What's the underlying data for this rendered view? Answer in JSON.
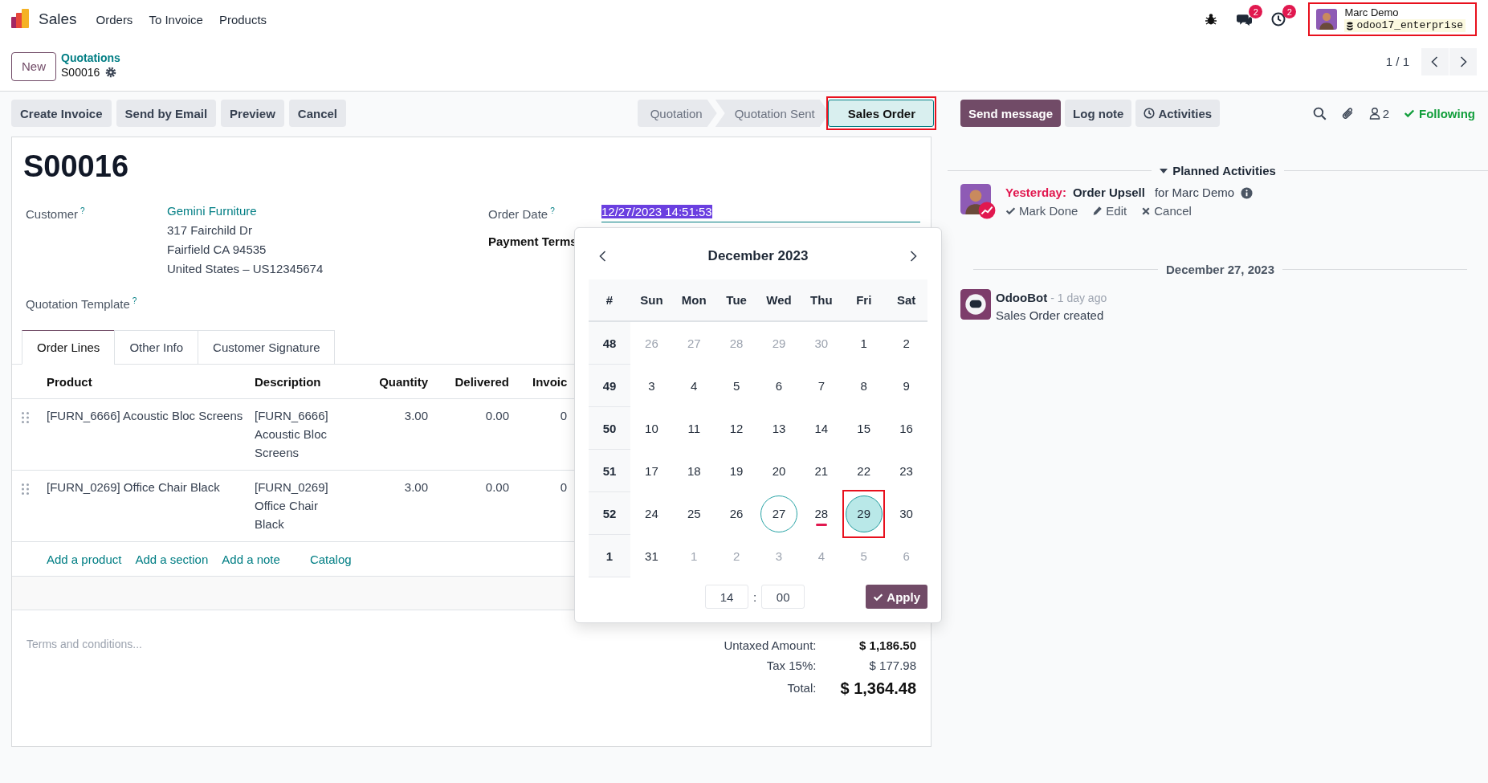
{
  "navbar": {
    "app_name": "Sales",
    "menu": [
      {
        "label": "Orders"
      },
      {
        "label": "To Invoice"
      },
      {
        "label": "Products"
      }
    ],
    "systray": [
      {
        "kind": "debug"
      },
      {
        "kind": "messages",
        "badge": "2"
      },
      {
        "kind": "activities",
        "badge": "2"
      }
    ],
    "user": {
      "name": "Marc Demo",
      "database": "odoo17_enterprise",
      "highlighted": true
    }
  },
  "control_panel": {
    "new_button": "New",
    "breadcrumb": {
      "parent": "Quotations",
      "current": "S00016"
    },
    "pager": "1 / 1"
  },
  "actions": [
    {
      "label": "Create Invoice"
    },
    {
      "label": "Send by Email"
    },
    {
      "label": "Preview"
    },
    {
      "label": "Cancel"
    }
  ],
  "status_bar": [
    {
      "label": "Quotation",
      "selected": false,
      "highlighted": false
    },
    {
      "label": "Quotation Sent",
      "selected": false,
      "highlighted": false
    },
    {
      "label": "Sales Order",
      "selected": true,
      "highlighted": true
    }
  ],
  "form": {
    "title": "S00016",
    "customer": {
      "label": "Customer",
      "help": "?",
      "required": false,
      "name": "Gemini Furniture",
      "address": [
        "317 Fairchild Dr",
        "Fairfield CA 94535",
        "United States – US12345674"
      ]
    },
    "quotation_template": {
      "label": "Quotation Template",
      "help": "?",
      "required": false
    },
    "order_date": {
      "label": "Order Date",
      "help": "?",
      "required": false,
      "value": "12/27/2023 14:51:53",
      "text_selected": true
    },
    "payment_terms": {
      "label": "Payment Terms",
      "required": true
    },
    "tabs": [
      {
        "label": "Order Lines",
        "selected": true
      },
      {
        "label": "Other Info",
        "selected": false
      },
      {
        "label": "Customer Signature",
        "selected": false
      }
    ],
    "table": {
      "columns": [
        "Product",
        "Description",
        "Quantity",
        "Delivered",
        "Invoic"
      ],
      "rows": [
        {
          "cells": [
            "[FURN_6666] Acoustic Bloc Screens",
            "[FURN_6666] Acoustic Bloc Screens",
            "3.00",
            "0.00",
            "0"
          ]
        },
        {
          "cells": [
            "[FURN_0269] Office Chair Black",
            "[FURN_0269] Office Chair Black",
            "3.00",
            "0.00",
            "0"
          ]
        }
      ]
    },
    "add_links": [
      {
        "label": "Add a product"
      },
      {
        "label": "Add a section"
      },
      {
        "label": "Add a note"
      },
      {
        "label": "Catalog"
      }
    ],
    "notes_placeholder": "Terms and conditions...",
    "totals": [
      {
        "label": "Untaxed Amount:",
        "value": "$ 1,186.50",
        "kind": "subtotal"
      },
      {
        "label": "Tax 15%:",
        "value": "$ 177.98",
        "kind": "tax"
      },
      {
        "label": "Total:",
        "value": "$ 1,364.48",
        "kind": "total"
      }
    ]
  },
  "datepicker": {
    "month": "December 2023",
    "week_header": "#",
    "weekdays": [
      "Sun",
      "Mon",
      "Tue",
      "Wed",
      "Thu",
      "Fri",
      "Sat"
    ],
    "weeks": [
      {
        "number": "48",
        "days": [
          {
            "label": "26",
            "kind": "other_month",
            "selected": false,
            "highlighted": false
          },
          {
            "label": "27",
            "kind": "other_month",
            "selected": false,
            "highlighted": false
          },
          {
            "label": "28",
            "kind": "other_month",
            "selected": false,
            "highlighted": false
          },
          {
            "label": "29",
            "kind": "other_month",
            "selected": false,
            "highlighted": false
          },
          {
            "label": "30",
            "kind": "other_month",
            "selected": false,
            "highlighted": false
          },
          {
            "label": "1",
            "kind": "normal",
            "selected": false,
            "highlighted": false
          },
          {
            "label": "2",
            "kind": "normal",
            "selected": false,
            "highlighted": false
          }
        ]
      },
      {
        "number": "49",
        "days": [
          {
            "label": "3",
            "kind": "normal",
            "selected": false,
            "highlighted": false
          },
          {
            "label": "4",
            "kind": "normal",
            "selected": false,
            "highlighted": false
          },
          {
            "label": "5",
            "kind": "normal",
            "selected": false,
            "highlighted": false
          },
          {
            "label": "6",
            "kind": "normal",
            "selected": false,
            "highlighted": false
          },
          {
            "label": "7",
            "kind": "normal",
            "selected": false,
            "highlighted": false
          },
          {
            "label": "8",
            "kind": "normal",
            "selected": false,
            "highlighted": false
          },
          {
            "label": "9",
            "kind": "normal",
            "selected": false,
            "highlighted": false
          }
        ]
      },
      {
        "number": "50",
        "days": [
          {
            "label": "10",
            "kind": "normal",
            "selected": false,
            "highlighted": false
          },
          {
            "label": "11",
            "kind": "normal",
            "selected": false,
            "highlighted": false
          },
          {
            "label": "12",
            "kind": "normal",
            "selected": false,
            "highlighted": false
          },
          {
            "label": "13",
            "kind": "normal",
            "selected": false,
            "highlighted": false
          },
          {
            "label": "14",
            "kind": "normal",
            "selected": false,
            "highlighted": false
          },
          {
            "label": "15",
            "kind": "normal",
            "selected": false,
            "highlighted": false
          },
          {
            "label": "16",
            "kind": "normal",
            "selected": false,
            "highlighted": false
          }
        ]
      },
      {
        "number": "51",
        "days": [
          {
            "label": "17",
            "kind": "normal",
            "selected": false,
            "highlighted": false
          },
          {
            "label": "18",
            "kind": "normal",
            "selected": false,
            "highlighted": false
          },
          {
            "label": "19",
            "kind": "normal",
            "selected": false,
            "highlighted": false
          },
          {
            "label": "20",
            "kind": "normal",
            "selected": false,
            "highlighted": false
          },
          {
            "label": "21",
            "kind": "normal",
            "selected": false,
            "highlighted": false
          },
          {
            "label": "22",
            "kind": "normal",
            "selected": false,
            "highlighted": false
          },
          {
            "label": "23",
            "kind": "normal",
            "selected": false,
            "highlighted": false
          }
        ]
      },
      {
        "number": "52",
        "days": [
          {
            "label": "24",
            "kind": "normal",
            "selected": false,
            "highlighted": false
          },
          {
            "label": "25",
            "kind": "normal",
            "selected": false,
            "highlighted": false
          },
          {
            "label": "26",
            "kind": "normal",
            "selected": false,
            "highlighted": false
          },
          {
            "label": "27",
            "kind": "current",
            "selected": false,
            "highlighted": false
          },
          {
            "label": "28",
            "kind": "today",
            "selected": false,
            "highlighted": false
          },
          {
            "label": "29",
            "kind": "normal",
            "selected": true,
            "highlighted": true
          },
          {
            "label": "30",
            "kind": "normal",
            "selected": false,
            "highlighted": false
          }
        ]
      },
      {
        "number": "1",
        "days": [
          {
            "label": "31",
            "kind": "normal",
            "selected": false,
            "highlighted": false
          },
          {
            "label": "1",
            "kind": "other_month",
            "selected": false,
            "highlighted": false
          },
          {
            "label": "2",
            "kind": "other_month",
            "selected": false,
            "highlighted": false
          },
          {
            "label": "3",
            "kind": "other_month",
            "selected": false,
            "highlighted": false
          },
          {
            "label": "4",
            "kind": "other_month",
            "selected": false,
            "highlighted": false
          },
          {
            "label": "5",
            "kind": "other_month",
            "selected": false,
            "highlighted": false
          },
          {
            "label": "6",
            "kind": "other_month",
            "selected": false,
            "highlighted": false
          }
        ]
      }
    ],
    "hour": "14",
    "separator": ":",
    "minute": "00",
    "apply": "Apply"
  },
  "chatter": {
    "buttons": [
      {
        "label": "Send message",
        "kind": "primary"
      },
      {
        "label": "Log note",
        "kind": "secondary"
      },
      {
        "label": "Activities",
        "kind": "activities"
      }
    ],
    "follower_count": "2",
    "follow_label": "Following",
    "activities_header": "Planned Activities",
    "activities": [
      {
        "due": "Yesterday:",
        "summary": "Order Upsell",
        "assignee": "for Marc Demo",
        "actions": [
          {
            "kind": "done",
            "label": "Mark Done"
          },
          {
            "kind": "edit",
            "label": "Edit"
          },
          {
            "kind": "cancel",
            "label": "Cancel"
          }
        ]
      }
    ],
    "date_separator": "December 27, 2023",
    "messages": [
      {
        "author": "OdooBot",
        "time": "- 1 day ago",
        "body": "Sales Order created"
      }
    ]
  }
}
